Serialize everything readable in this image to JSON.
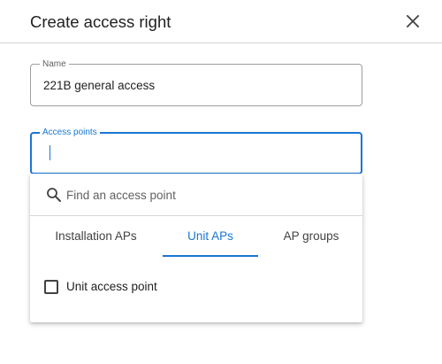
{
  "dialog": {
    "title": "Create access right",
    "close_icon": "close-icon"
  },
  "name_field": {
    "label": "Name",
    "value": "221B general access"
  },
  "access_points_field": {
    "label": "Access points",
    "value": "",
    "focused": true
  },
  "dropdown": {
    "search": {
      "icon": "search-icon",
      "placeholder": "Find an access point",
      "value": ""
    },
    "tabs": [
      {
        "label": "Installation APs",
        "active": false
      },
      {
        "label": "Unit APs",
        "active": true
      },
      {
        "label": "AP groups",
        "active": false
      }
    ],
    "options": [
      {
        "label": "Unit access point",
        "checked": false
      }
    ]
  },
  "colors": {
    "accent": "#1976d2",
    "text": "#212121",
    "muted": "#616161",
    "divider": "#d6d6d6"
  }
}
